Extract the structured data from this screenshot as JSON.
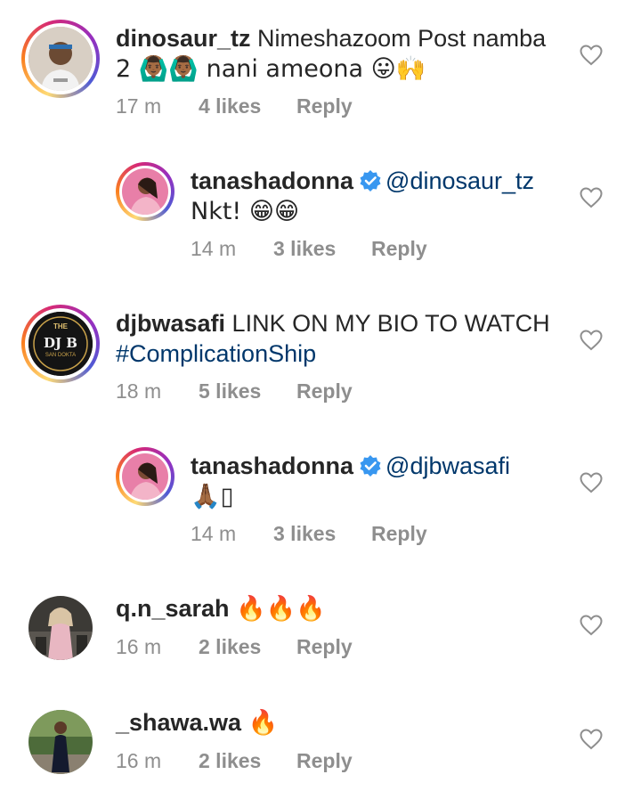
{
  "comments": [
    {
      "username": "dinosaur_tz",
      "text_line1": "Nimeshazoom Post namba",
      "text_line2": "2 🙆🏾‍♂️🙆🏾‍♂️ nani ameona 😛🙌",
      "time": "17 m",
      "likes": "4 likes",
      "reply": "Reply"
    },
    {
      "username": "tanashadonna",
      "mention": "@dinosaur_tz",
      "text_line2": "Nkt! 😁😁",
      "time": "14 m",
      "likes": "3 likes",
      "reply": "Reply"
    },
    {
      "username": "djbwasafi",
      "text_line1": "LINK ON MY BIO TO WATCH",
      "hashtag": "#ComplicationShip",
      "avatar_text": "DJ B",
      "avatar_top": "THE",
      "avatar_bottom": "SAN DOKTA",
      "time": "18 m",
      "likes": "5 likes",
      "reply": "Reply"
    },
    {
      "username": "tanashadonna",
      "mention": "@djbwasafi",
      "text_line2": "🙏🏾▯",
      "time": "14 m",
      "likes": "3 likes",
      "reply": "Reply"
    },
    {
      "username": "q.n_sarah",
      "text_line1": "🔥🔥🔥",
      "time": "16 m",
      "likes": "2 likes",
      "reply": "Reply"
    },
    {
      "username": "_shawa.wa",
      "text_line1": "🔥",
      "time": "16 m",
      "likes": "2 likes",
      "reply": "Reply"
    }
  ],
  "colors": {
    "text": "#262626",
    "meta": "#8e8e8e",
    "link": "#00376b",
    "verified": "#3897f0"
  }
}
